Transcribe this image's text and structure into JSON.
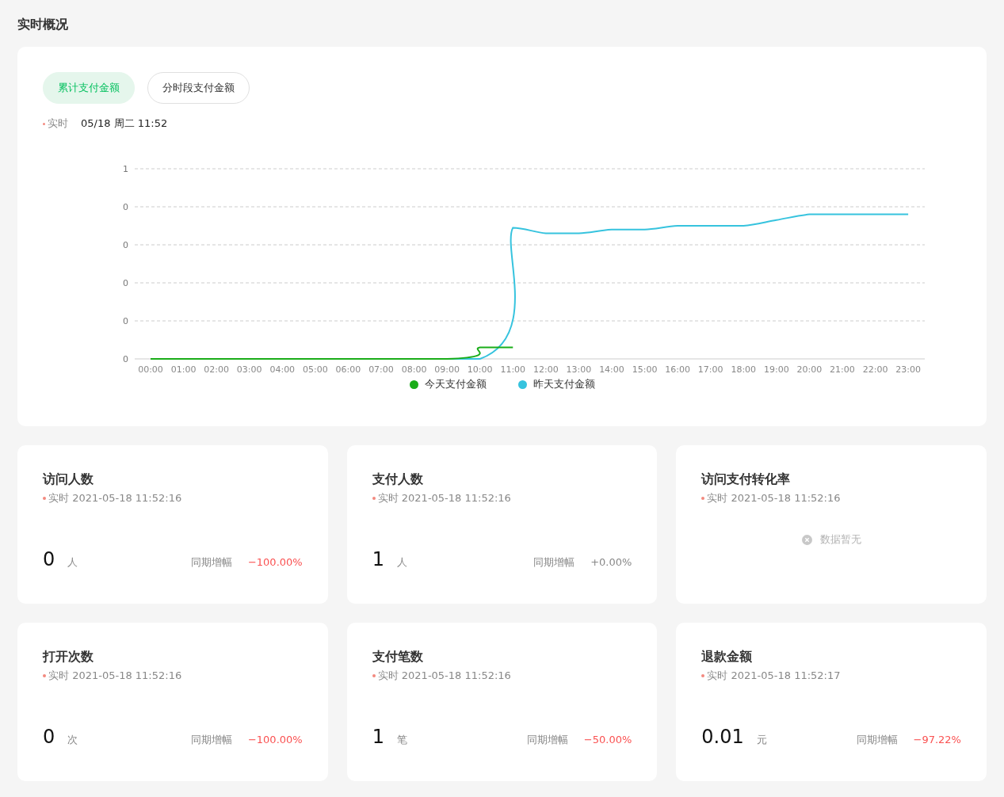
{
  "page_title": "实时概况",
  "overview": {
    "tabs": [
      {
        "label": "累计支付金额",
        "selected": true
      },
      {
        "label": "分时段支付金额",
        "selected": false
      }
    ],
    "realtime_label": "实时",
    "realtime_value": "05/18 周二 11:52",
    "chart": {
      "y_axis_labels": [
        "1",
        "0",
        "0",
        "0",
        "0",
        "0"
      ],
      "x_axis_labels": [
        "00:00",
        "01:00",
        "02:00",
        "03:00",
        "04:00",
        "05:00",
        "06:00",
        "07:00",
        "08:00",
        "09:00",
        "10:00",
        "11:00",
        "12:00",
        "13:00",
        "14:00",
        "15:00",
        "16:00",
        "17:00",
        "18:00",
        "19:00",
        "20:00",
        "21:00",
        "22:00",
        "23:00"
      ],
      "legend": [
        {
          "label": "今天支付金额",
          "color": "#1aad19"
        },
        {
          "label": "昨天支付金额",
          "color": "#36c3de"
        }
      ]
    }
  },
  "stats": [
    {
      "kind": "value",
      "title": "访问人数",
      "time_label": "实时",
      "time": "2021-05-18 11:52:16",
      "value": "0",
      "unit": "人",
      "compare_label": "同期增幅",
      "change": "−100.00%",
      "color": "#fa5151"
    },
    {
      "kind": "value",
      "title": "支付人数",
      "time_label": "实时",
      "time": "2021-05-18 11:52:16",
      "value": "1",
      "unit": "人",
      "compare_label": "同期增幅",
      "change": "+0.00%",
      "color": "#888888"
    },
    {
      "kind": "empty",
      "title": "访问支付转化率",
      "time_label": "实时",
      "time": "2021-05-18 11:52:16",
      "empty_text": "数据暂无"
    },
    {
      "kind": "value",
      "title": "打开次数",
      "time_label": "实时",
      "time": "2021-05-18 11:52:16",
      "value": "0",
      "unit": "次",
      "compare_label": "同期增幅",
      "change": "−100.00%",
      "color": "#fa5151"
    },
    {
      "kind": "value",
      "title": "支付笔数",
      "time_label": "实时",
      "time": "2021-05-18 11:52:16",
      "value": "1",
      "unit": "笔",
      "compare_label": "同期增幅",
      "change": "−50.00%",
      "color": "#fa5151"
    },
    {
      "kind": "value",
      "title": "退款金额",
      "time_label": "实时",
      "time": "2021-05-18 11:52:17",
      "value": "0.01",
      "unit": "元",
      "compare_label": "同期增幅",
      "change": "−97.22%",
      "color": "#fa5151"
    }
  ]
}
